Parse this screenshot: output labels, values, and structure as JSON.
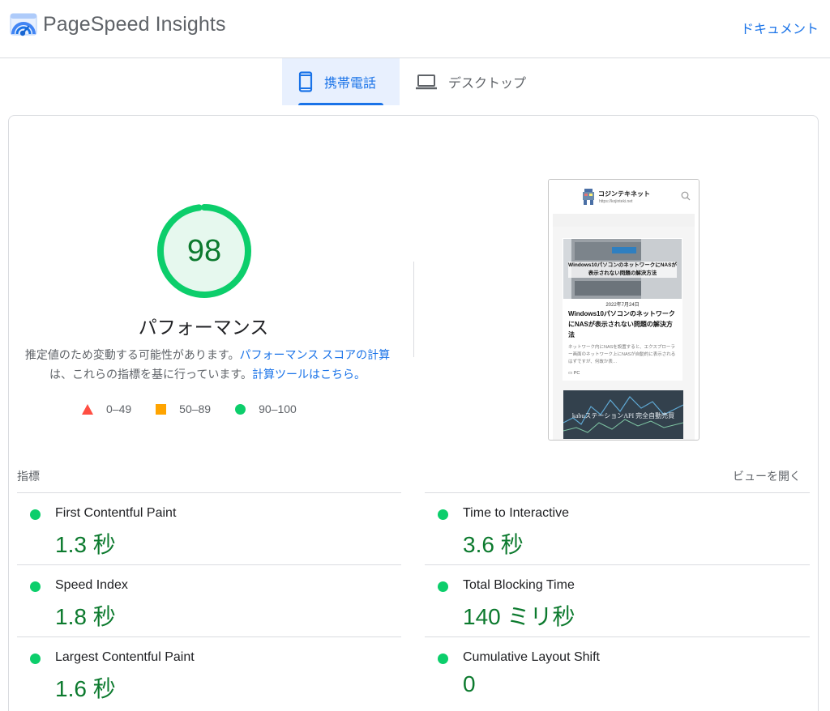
{
  "header": {
    "brand": "PageSpeed Insights",
    "docs_link": "ドキュメント"
  },
  "tabs": [
    {
      "label": "携帯電話",
      "icon": "smartphone-icon",
      "selected": true
    },
    {
      "label": "デスクトップ",
      "icon": "laptop-icon",
      "selected": false
    }
  ],
  "performance": {
    "score": "98",
    "title": "パフォーマンス",
    "desc_1": "推定値のため変動する可能性があります。",
    "desc_link_1": "パフォーマンス スコアの計算",
    "desc_2": "は、これらの指標を基に行っています。",
    "desc_link_2": "計算ツールはこちら。",
    "gauge_fraction": 0.98,
    "colors": {
      "pass": "#0cce6b",
      "average": "#ffa400",
      "fail": "#ff4e42",
      "score_text": "#0c7a2e"
    }
  },
  "legend": [
    {
      "shape": "triangle",
      "range": "0–49"
    },
    {
      "shape": "square",
      "range": "50–89"
    },
    {
      "shape": "circle",
      "range": "90–100"
    }
  ],
  "screenshot": {
    "site_name": "コジンテキネット",
    "site_url": "https://kojinteki.net",
    "image_caption": "Windows10パソコンのネットワークにNASが表示されない問題の解決方法",
    "date": "2022年7月24日",
    "title": "Windows10パソコンのネットワークにNASが表示されない問題の解決方法",
    "excerpt": "ネットワーク内にNASを設置すると、エクスプローラー画面のネットワーク上にNASが自動的に表示されるはずですが、何故か表…",
    "category": "PC",
    "card2_caption": "kabuステーションAPI 完全自動売買"
  },
  "metrics": {
    "label": "指標",
    "expand": "ビューを開く",
    "items": [
      {
        "name": "First Contentful Paint",
        "value": "1.3 秒"
      },
      {
        "name": "Time to Interactive",
        "value": "3.6 秒"
      },
      {
        "name": "Speed Index",
        "value": "1.8 秒"
      },
      {
        "name": "Total Blocking Time",
        "value": "140 ミリ秒"
      },
      {
        "name": "Largest Contentful Paint",
        "value": "1.6 秒"
      },
      {
        "name": "Cumulative Layout Shift",
        "value": "0"
      }
    ]
  }
}
